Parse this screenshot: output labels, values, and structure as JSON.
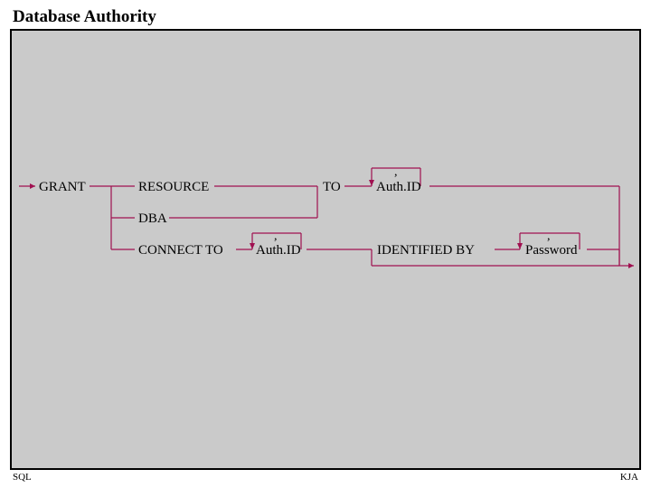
{
  "title": "Database Authority",
  "footer_left": "SQL",
  "footer_right": "KJA",
  "diagram": {
    "kw_grant": "GRANT",
    "kw_resource": "RESOURCE",
    "kw_to": "TO",
    "kw_authid_top": "Auth.ID",
    "kw_dba": "DBA",
    "kw_connect_to": "CONNECT TO",
    "kw_authid_mid": "Auth.ID",
    "kw_identified_by": "IDENTIFIED BY",
    "kw_password": "Password",
    "comma": ","
  }
}
